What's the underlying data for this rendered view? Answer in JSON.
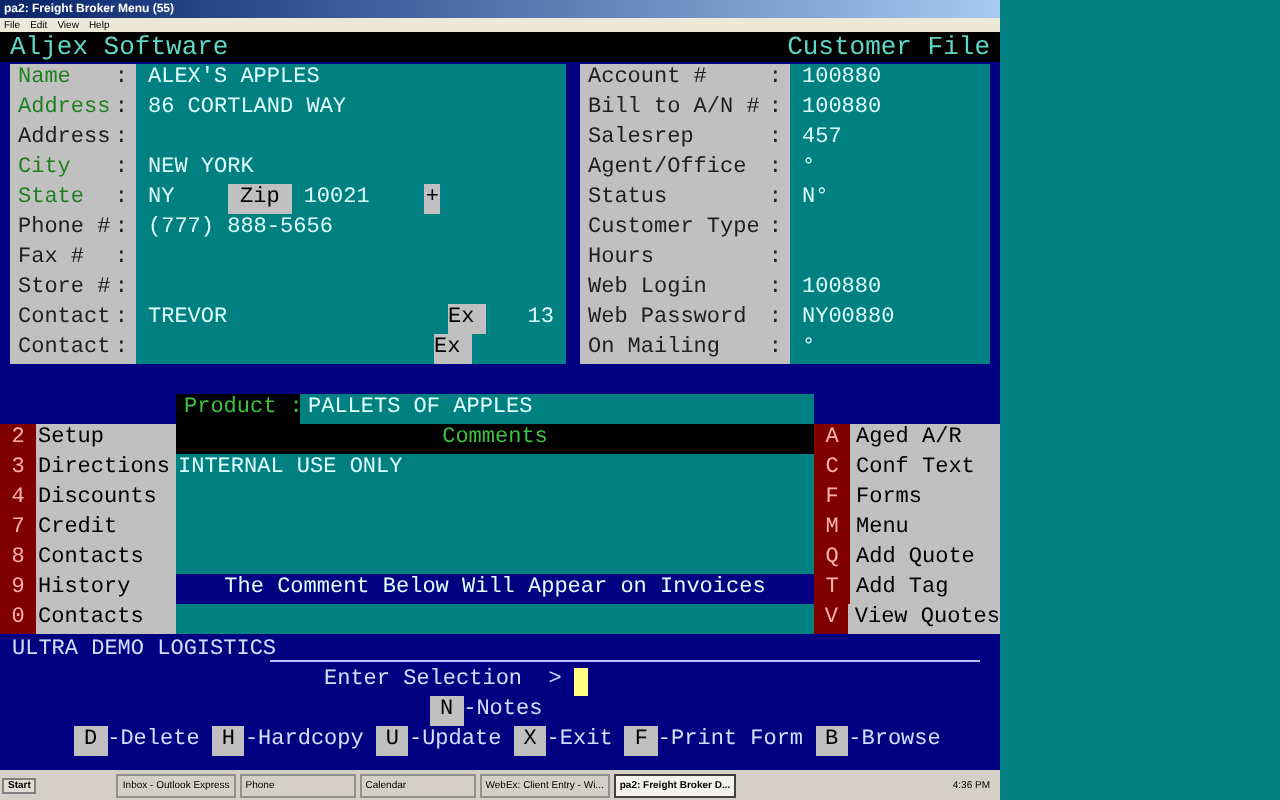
{
  "window": {
    "title": "pa2: Freight Broker Menu (55)",
    "menu": [
      "File",
      "Edit",
      "View",
      "Help"
    ]
  },
  "separator": ":",
  "header": {
    "app": "Aljex Software",
    "screen": "Customer File"
  },
  "customer_fields": [
    {
      "label": "Name",
      "value": "ALEX'S APPLES",
      "required": true
    },
    {
      "label": "Address",
      "value": "86 CORTLAND WAY",
      "required": true
    },
    {
      "label": "Address",
      "required": false
    },
    {
      "label": "City",
      "value": "NEW YORK",
      "required": true
    },
    {
      "label": "State",
      "value": "NY",
      "required": true,
      "zip_label": "Zip",
      "zip": "10021",
      "marker": "+"
    },
    {
      "label": "Phone #",
      "value": "(777) 888-5656",
      "required": false
    },
    {
      "label": "Fax #",
      "required": false
    },
    {
      "label": "Store #",
      "required": false
    },
    {
      "label": "Contact",
      "value": "TREVOR",
      "required": false,
      "ext_label": "Ex",
      "ext": "13"
    },
    {
      "label": "Contact",
      "required": false,
      "ext_label": "Ex"
    }
  ],
  "account_fields": [
    {
      "label": "Account #",
      "value": "100880"
    },
    {
      "label": "Bill to A/N #",
      "value": "100880"
    },
    {
      "label": "Salesrep",
      "value": "457"
    },
    {
      "label": "Agent/Office",
      "value": "°"
    },
    {
      "label": "Status",
      "value": "N°"
    },
    {
      "label": "Customer Type"
    },
    {
      "label": "Hours"
    },
    {
      "label": "Web Login",
      "value": "100880"
    },
    {
      "label": "Web Password",
      "value": "NY00880"
    },
    {
      "label": "On Mailing",
      "value": "°"
    }
  ],
  "product": {
    "label": "Product :",
    "value": "PALLETS OF APPLES"
  },
  "comments": {
    "header": "Comments",
    "text": "INTERNAL USE ONLY",
    "invoice_notice": "The Comment Below Will Appear on Invoices"
  },
  "left_menu": [
    {
      "key": "2",
      "label": "Setup"
    },
    {
      "key": "3",
      "label": "Directions"
    },
    {
      "key": "4",
      "label": "Discounts"
    },
    {
      "key": "7",
      "label": "Credit"
    },
    {
      "key": "8",
      "label": "Contacts"
    },
    {
      "key": "9",
      "label": "History"
    },
    {
      "key": "0",
      "label": "Contacts"
    }
  ],
  "right_menu": [
    {
      "key": "A",
      "label": "Aged A/R"
    },
    {
      "key": "C",
      "label": "Conf Text"
    },
    {
      "key": "F",
      "label": "Forms"
    },
    {
      "key": "M",
      "label": "Menu"
    },
    {
      "key": "Q",
      "label": "Add Quote"
    },
    {
      "key": "T",
      "label": "Add Tag"
    },
    {
      "key": "V",
      "label": "View Quotes"
    }
  ],
  "company": "ULTRA DEMO LOGISTICS",
  "prompt": "Enter Selection  >",
  "notes_command": {
    "key": "N",
    "label": "-Notes"
  },
  "commands": [
    {
      "key": "D",
      "label": "-Delete"
    },
    {
      "key": "H",
      "label": "-Hardcopy"
    },
    {
      "key": "U",
      "label": "-Update"
    },
    {
      "key": "X",
      "label": "-Exit"
    },
    {
      "key": "F",
      "label": "-Print Form"
    },
    {
      "key": "B",
      "label": "-Browse"
    }
  ],
  "taskbar": {
    "start": "Start",
    "tasks": [
      {
        "label": "Inbox - Outlook Express",
        "selected": false
      },
      {
        "label": "Phone",
        "selected": false
      },
      {
        "label": "Calendar",
        "selected": false
      },
      {
        "label": "WebEx: Client Entry - Wi...",
        "selected": false
      },
      {
        "label": "pa2: Freight Broker D...",
        "selected": true
      }
    ],
    "clock": "4:36 PM"
  }
}
